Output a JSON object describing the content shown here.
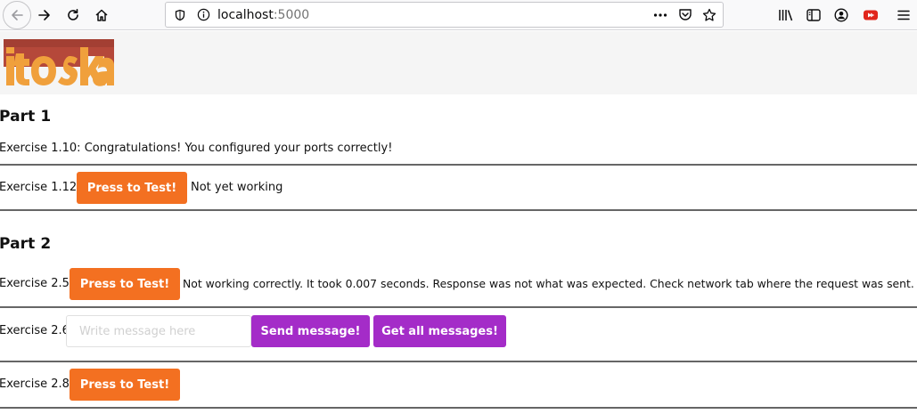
{
  "browser": {
    "url_host": "localhost",
    "url_port": ":5000",
    "colors": {
      "toolbar": "#f9f9fa",
      "urlbar_border": "#c7c7cb"
    }
  },
  "header": {
    "logo_text": "toska",
    "colors": {
      "logo_orange": "#f0a03c",
      "logo_red": "#b5483a"
    }
  },
  "part1": {
    "title": "Part 1",
    "ex110": {
      "label": "Exercise 1.10:",
      "text": "Congratulations! You configured your ports correctly!"
    },
    "ex112": {
      "label": "Exercise 1.12:",
      "button": "Press to Test!",
      "status": "Not yet working"
    }
  },
  "part2": {
    "title": "Part 2",
    "ex25": {
      "label": "Exercise 2.5:",
      "button": "Press to Test!",
      "status": "Not working correctly. It took 0.007 seconds. Response was not what was expected. Check network tab where the request was sent."
    },
    "ex26": {
      "label": "Exercise 2.6:",
      "input_placeholder": "Write message here",
      "input_value": "",
      "send_button": "Send message!",
      "get_button": "Get all messages!"
    },
    "ex28": {
      "label": "Exercise 2.8:",
      "button": "Press to Test!"
    }
  },
  "colors": {
    "orange_button": "#f37021",
    "purple_button": "#a42cc8",
    "divider": "#666666"
  },
  "icons": [
    "back-icon",
    "forward-icon",
    "reload-icon",
    "home-icon",
    "site-info-icon",
    "info-icon",
    "more-icon",
    "pocket-icon",
    "bookmark-star-icon",
    "library-icon",
    "sidebar-icon",
    "account-icon",
    "youtube-extension-icon",
    "menu-icon"
  ]
}
